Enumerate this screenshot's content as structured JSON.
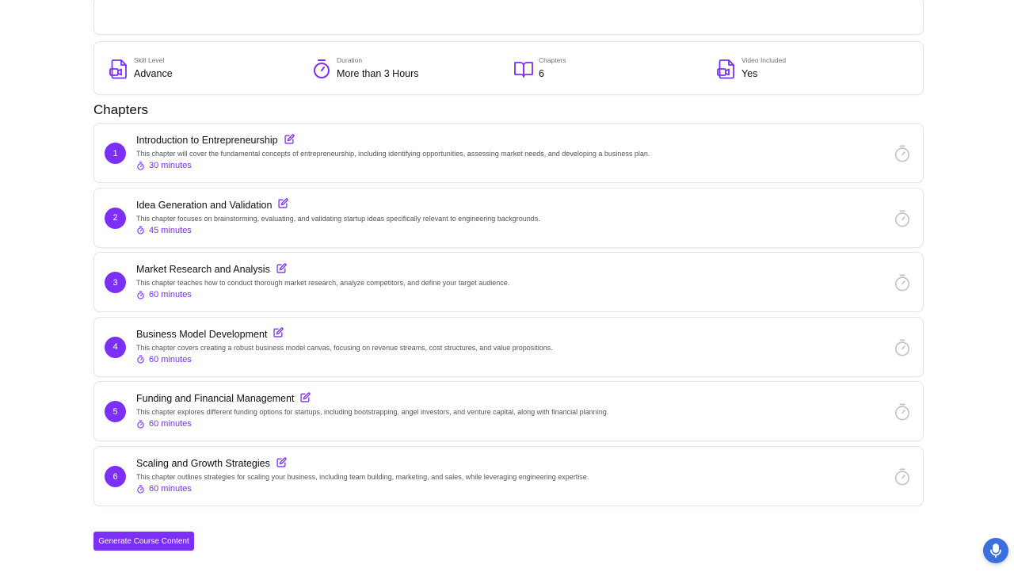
{
  "info": {
    "skill": {
      "label": "Skill Level",
      "value": "Advance",
      "icon": "video-file-icon"
    },
    "duration": {
      "label": "Duration",
      "value": "More than 3 Hours",
      "icon": "timer-icon"
    },
    "chapters": {
      "label": "Chapters",
      "value": "6",
      "icon": "book-icon"
    },
    "video": {
      "label": "Video Included",
      "value": "Yes",
      "icon": "video-file-icon"
    }
  },
  "chapters_heading": "Chapters",
  "chapters": [
    {
      "num": "1",
      "title": "Introduction to Entrepreneurship",
      "desc": "This chapter will cover the fundamental concepts of entrepreneurship, including identifying opportunities, assessing market needs, and developing a business plan.",
      "duration": "30 minutes"
    },
    {
      "num": "2",
      "title": "Idea Generation and Validation",
      "desc": "This chapter focuses on brainstorming, evaluating, and validating startup ideas specifically relevant to engineering backgrounds.",
      "duration": "45 minutes"
    },
    {
      "num": "3",
      "title": "Market Research and Analysis",
      "desc": "This chapter teaches how to conduct thorough market research, analyze competitors, and define your target audience.",
      "duration": "60 minutes"
    },
    {
      "num": "4",
      "title": "Business Model Development",
      "desc": "This chapter covers creating a robust business model canvas, focusing on revenue streams, cost structures, and value propositions.",
      "duration": "60 minutes"
    },
    {
      "num": "5",
      "title": "Funding and Financial Management",
      "desc": "This chapter explores different funding options for startups, including bootstrapping, angel investors, and venture capital, along with financial planning.",
      "duration": "60 minutes"
    },
    {
      "num": "6",
      "title": "Scaling and Growth Strategies",
      "desc": "This chapter outlines strategies for scaling your business, including team building, marketing, and sales, while leveraging engineering expertise.",
      "duration": "60 minutes"
    }
  ],
  "generate_button": "Generate Course Content",
  "colors": {
    "accent": "#7b2ff7",
    "mic": "#3b6fe0"
  }
}
